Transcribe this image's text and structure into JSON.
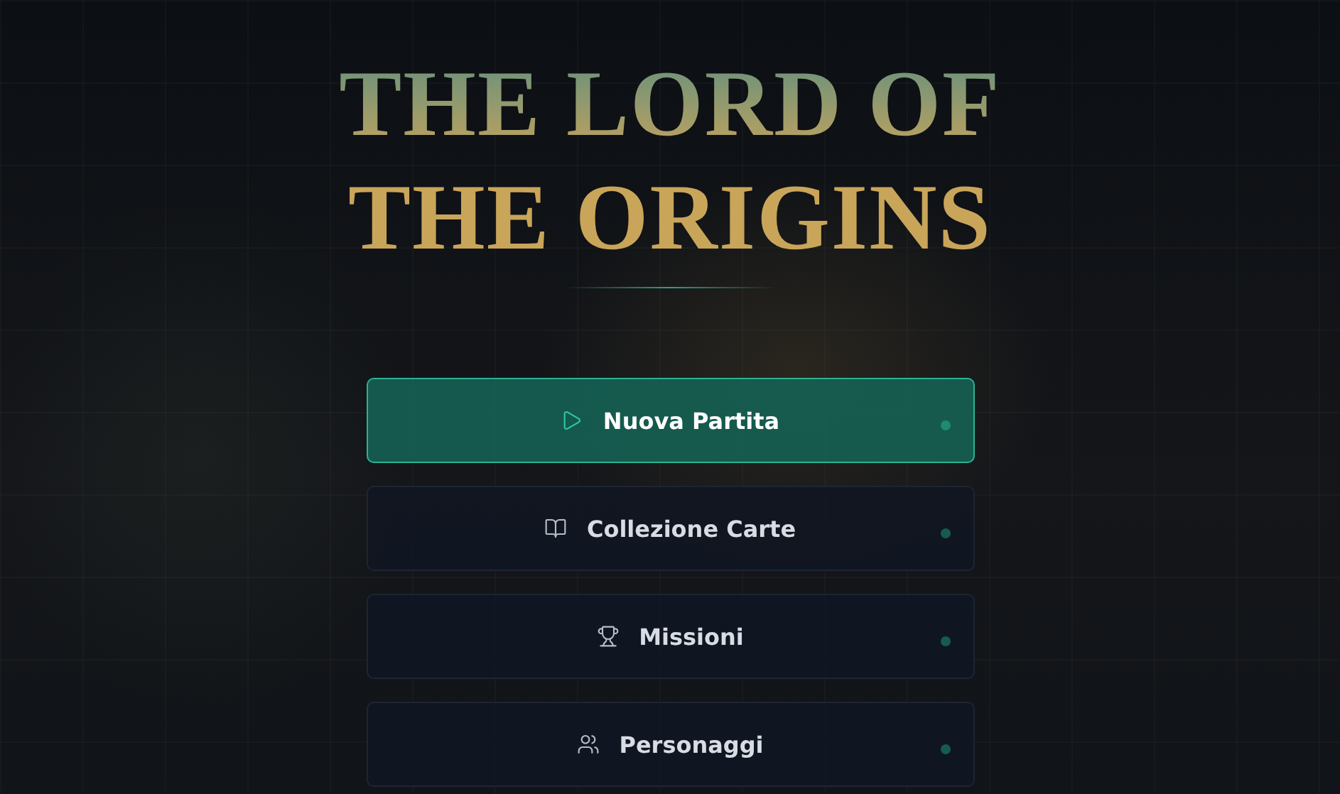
{
  "title": "THE LORD OF THE ORIGINS",
  "menu": [
    {
      "label": "Nuova Partita",
      "kind": "play",
      "selected": true
    },
    {
      "label": "Collezione Carte",
      "kind": "book",
      "selected": false
    },
    {
      "label": "Missioni",
      "kind": "trophy",
      "selected": false
    },
    {
      "label": "Personaggi",
      "kind": "users",
      "selected": false
    }
  ]
}
